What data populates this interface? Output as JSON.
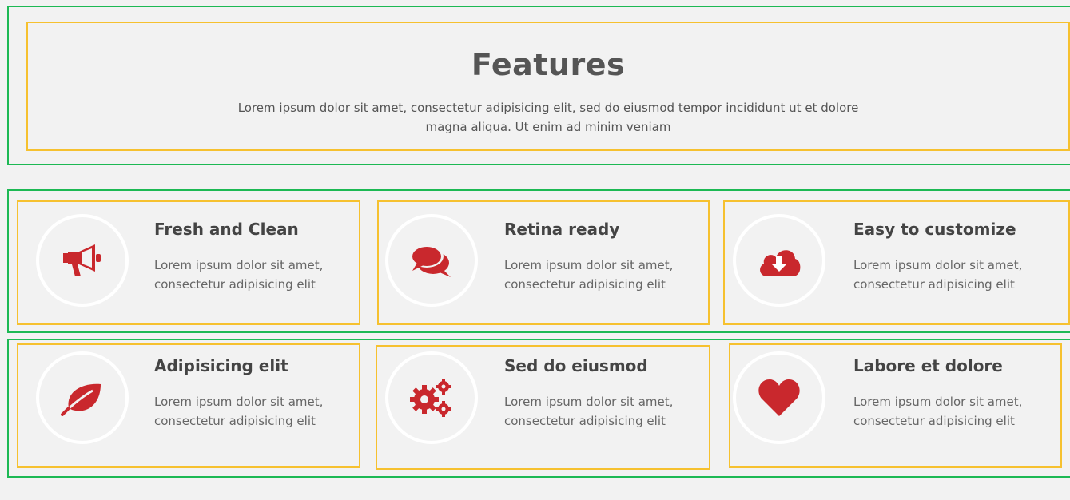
{
  "header": {
    "title": "Features",
    "description": "Lorem ipsum dolor sit amet, consectetur adipisicing elit, sed do eiusmod tempor incididunt ut et dolore magna aliqua. Ut enim ad minim veniam"
  },
  "features": [
    {
      "title": "Fresh and Clean",
      "text": "Lorem ipsum dolor sit amet, consectetur adipisicing elit",
      "icon": "megaphone-icon"
    },
    {
      "title": "Retina ready",
      "text": "Lorem ipsum dolor sit amet, consectetur adipisicing elit",
      "icon": "chat-bubbles-icon"
    },
    {
      "title": "Easy to customize",
      "text": "Lorem ipsum dolor sit amet, consectetur adipisicing elit",
      "icon": "cloud-download-icon"
    },
    {
      "title": "Adipisicing elit",
      "text": "Lorem ipsum dolor sit amet, consectetur adipisicing elit",
      "icon": "leaf-icon"
    },
    {
      "title": "Sed do eiusmod",
      "text": "Lorem ipsum dolor sit amet, consectetur adipisicing elit",
      "icon": "gears-icon"
    },
    {
      "title": "Labore et dolore",
      "text": "Lorem ipsum dolor sit amet, consectetur adipisicing elit",
      "icon": "heart-icon"
    }
  ],
  "colors": {
    "accent": "#c9282d",
    "outline_section": "#1db954",
    "outline_card": "#f6c12f",
    "background": "#f2f2f2"
  }
}
